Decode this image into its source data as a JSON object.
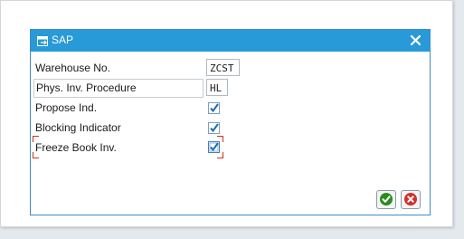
{
  "window": {
    "title": "SAP"
  },
  "fields": [
    {
      "label": "Warehouse No.",
      "value": "ZCST"
    },
    {
      "label": "Phys. Inv. Procedure",
      "value": "HL"
    }
  ],
  "checkboxes": [
    {
      "label": "Propose Ind.",
      "checked": true
    },
    {
      "label": "Blocking Indicator",
      "checked": true
    },
    {
      "label": "Freeze Book Inv.",
      "checked": true,
      "focused": true
    }
  ],
  "buttons": {
    "confirm_icon": "check-icon",
    "cancel_icon": "cancel-icon"
  },
  "colors": {
    "titlebar": "#289ad7",
    "accent": "#289ad7",
    "confirm": "#2e8b20",
    "cancel": "#d2302a",
    "focus": "#d0311e"
  }
}
